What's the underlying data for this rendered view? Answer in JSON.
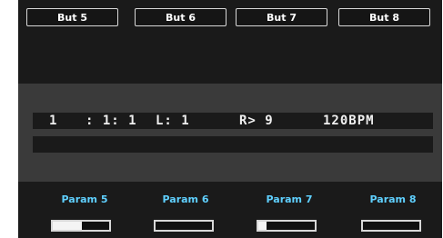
{
  "buttons": [
    {
      "label": "But 5"
    },
    {
      "label": "But 6"
    },
    {
      "label": "But 7"
    },
    {
      "label": "But 8"
    }
  ],
  "status": {
    "pattern": "1",
    "position": ": 1: 1",
    "length": "L: 1",
    "repeat": "R> 9",
    "tempo": "120BPM"
  },
  "params": [
    {
      "label": "Param 5",
      "value": 0.52
    },
    {
      "label": "Param 6",
      "value": 0.0
    },
    {
      "label": "Param 7",
      "value": 0.14
    },
    {
      "label": "Param 8",
      "value": 0.0
    }
  ],
  "colors": {
    "param_label": "#5fd0ff",
    "background": "#1a1a1a",
    "band": "#3a3a3a"
  }
}
